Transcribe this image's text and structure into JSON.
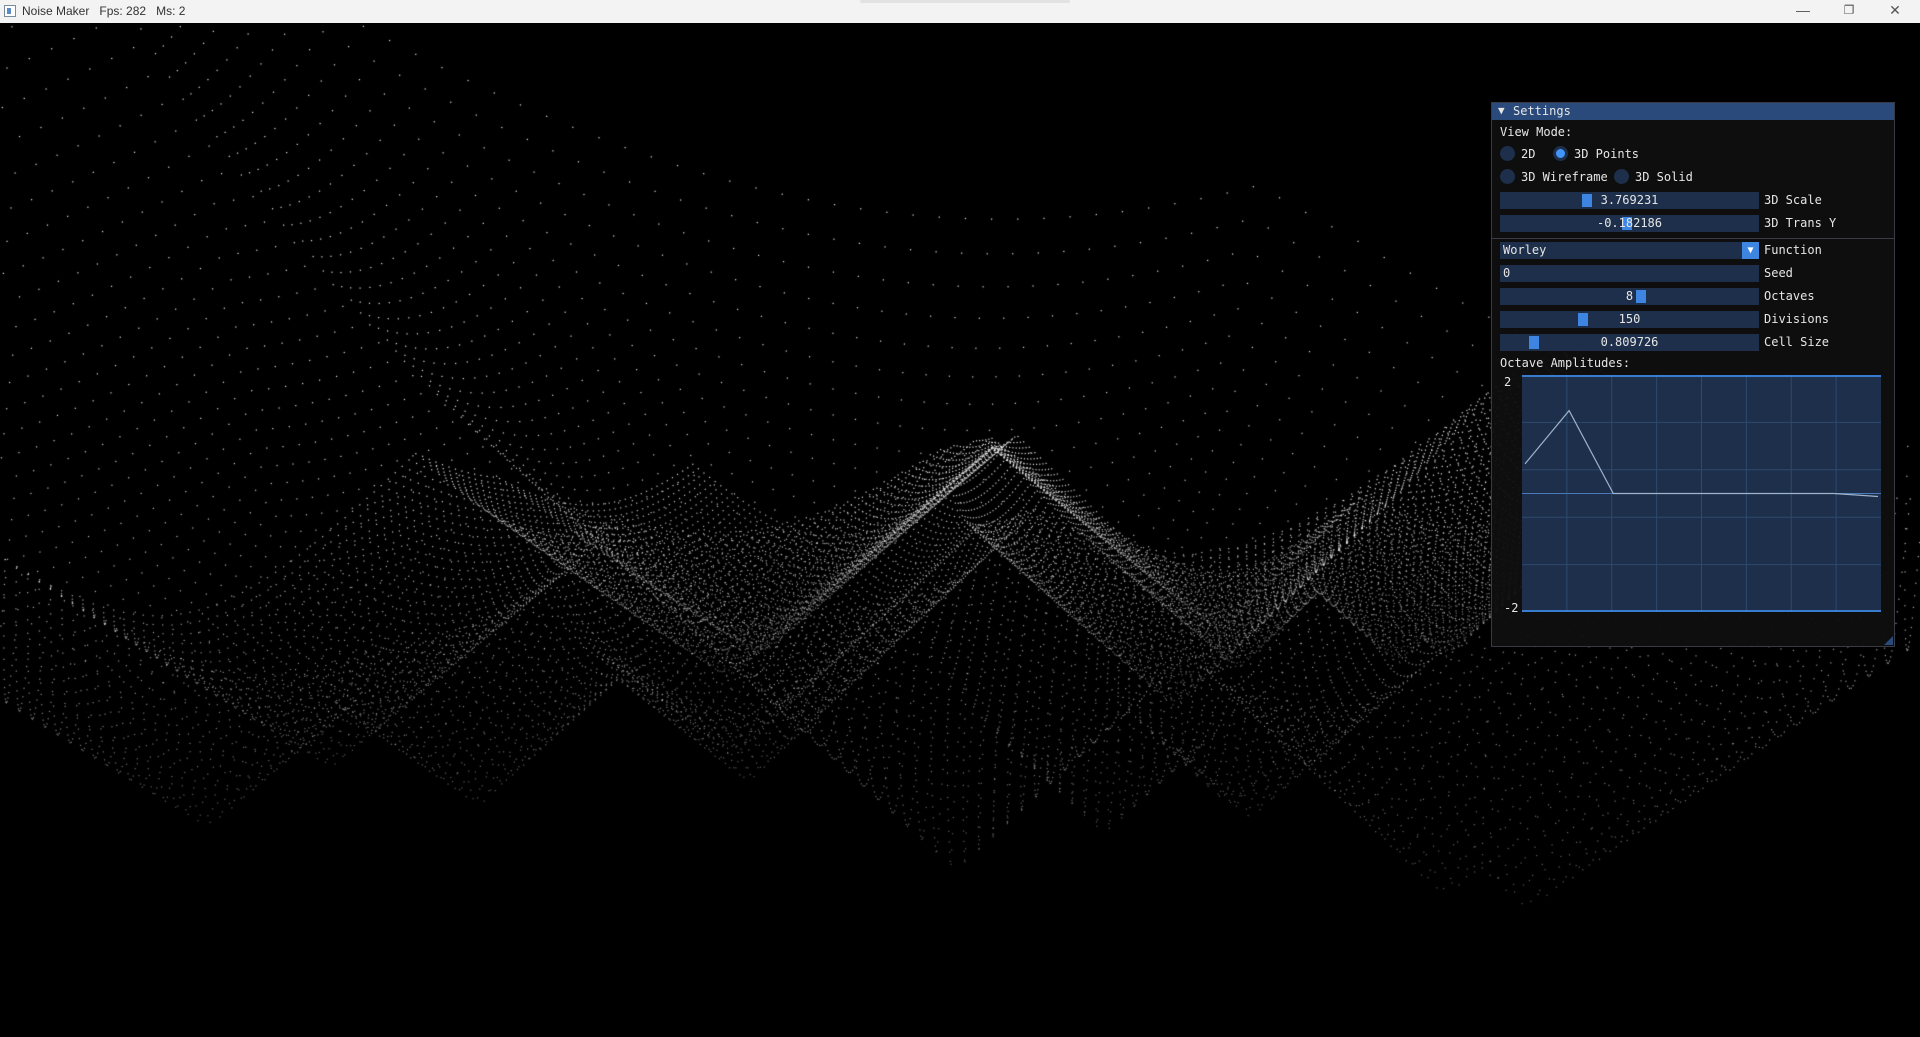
{
  "window": {
    "title": "Noise Maker",
    "fps_label": "Fps: 282",
    "ms_label": "Ms: 2",
    "minimize_glyph": "—",
    "maximize_glyph": "❐",
    "close_glyph": "✕"
  },
  "settings": {
    "header": "Settings",
    "view_mode_label": "View Mode:",
    "view_modes": [
      {
        "label": "2D",
        "selected": false
      },
      {
        "label": "3D Points",
        "selected": true
      },
      {
        "label": "3D Wireframe",
        "selected": false
      },
      {
        "label": "3D Solid",
        "selected": false
      }
    ],
    "scale": {
      "value": "3.769231",
      "label": "3D Scale"
    },
    "trans_y": {
      "value": "-0.182186",
      "label": "3D Trans Y"
    },
    "function": {
      "value": "Worley",
      "label": "Function"
    },
    "seed": {
      "value": "0",
      "label": "Seed"
    },
    "octaves": {
      "value": "8",
      "label": "Octaves"
    },
    "divisions": {
      "value": "150",
      "label": "Divisions"
    },
    "cell_size": {
      "value": "0.809726",
      "label": "Cell Size"
    },
    "amplitudes_label": "Octave Amplitudes:",
    "plot_max": "2",
    "plot_min": "-2",
    "amplitudes": [
      0.5,
      1.4,
      0.0,
      0.0,
      0.0,
      0.0,
      0.0,
      0.0,
      -0.05
    ]
  },
  "colors": {
    "accent": "#4296fa",
    "frame": "#1d2f4a",
    "header": "#294a7a"
  }
}
